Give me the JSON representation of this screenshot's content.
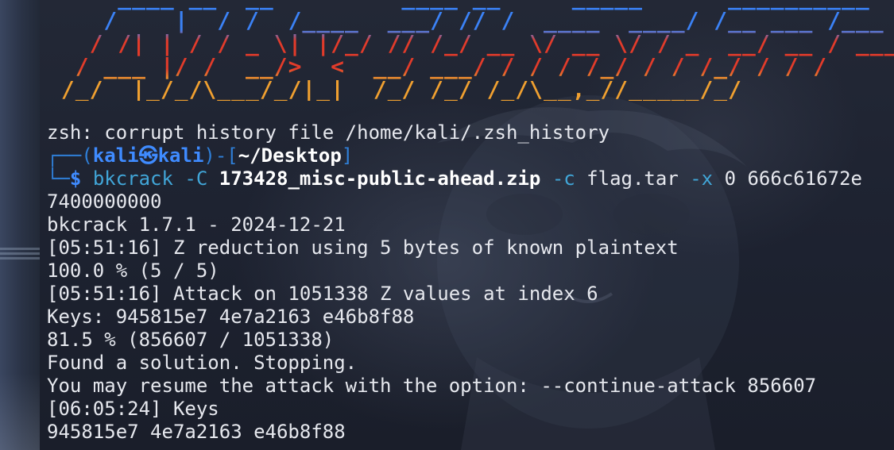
{
  "window": {
    "background_color": "#1b1f2a",
    "accent_blue": "#3f8bff",
    "banner_colors": [
      "#3b82f6",
      "#e23b2a",
      "#f0a030"
    ]
  },
  "banner": {
    "lines": [
      "     ____ __  __         ____ __     _____      __________  ",
      "    /    |  / /  /____  ___/ // /  ____  ____/ /__ ___ /___  ",
      "   / /| | / / _ \\| |/_/ // /_/ __ \\/ __ \\/ / _  __/ __ / ___/ ",
      "  / ___ |/ /  __/>  <  __/ ___/ / / / /_/ / / /_/ / / /    ",
      " /_/  |_/_/\\___/_/|_|  /_/ /_/ /_/\\__,_//_____/_/     "
    ]
  },
  "terminal": {
    "line_history_error": "zsh: corrupt history file /home/kali/.zsh_history",
    "prompt": {
      "frame_top": "┌──(",
      "user": "kali",
      "at_symbol": "㉿",
      "host": "kali",
      "frame_mid": ")-[",
      "path": "~/Desktop",
      "frame_end": "]",
      "frame_bottom": "└─",
      "dollar": "$"
    },
    "command": {
      "program": "bkcrack",
      "opt_C": "-C",
      "zip_file": "173428_misc-public-ahead.zip",
      "opt_c": "-c",
      "entry": "flag.tar",
      "opt_x": "-x",
      "offset": "0",
      "hex_part1": "666c61672e",
      "hex_part2": "7400000000"
    },
    "output": [
      "bkcrack 1.7.1 - 2024-12-21",
      "[05:51:16] Z reduction using 5 bytes of known plaintext",
      "100.0 % (5 / 5)",
      "[05:51:16] Attack on 1051338 Z values at index 6",
      "Keys: 945815e7 4e7a2163 e46b8f88",
      "81.5 % (856607 / 1051338)",
      "Found a solution. Stopping.",
      "You may resume the attack with the option: --continue-attack 856607",
      "[06:05:24] Keys",
      "945815e7 4e7a2163 e46b8f88"
    ]
  }
}
